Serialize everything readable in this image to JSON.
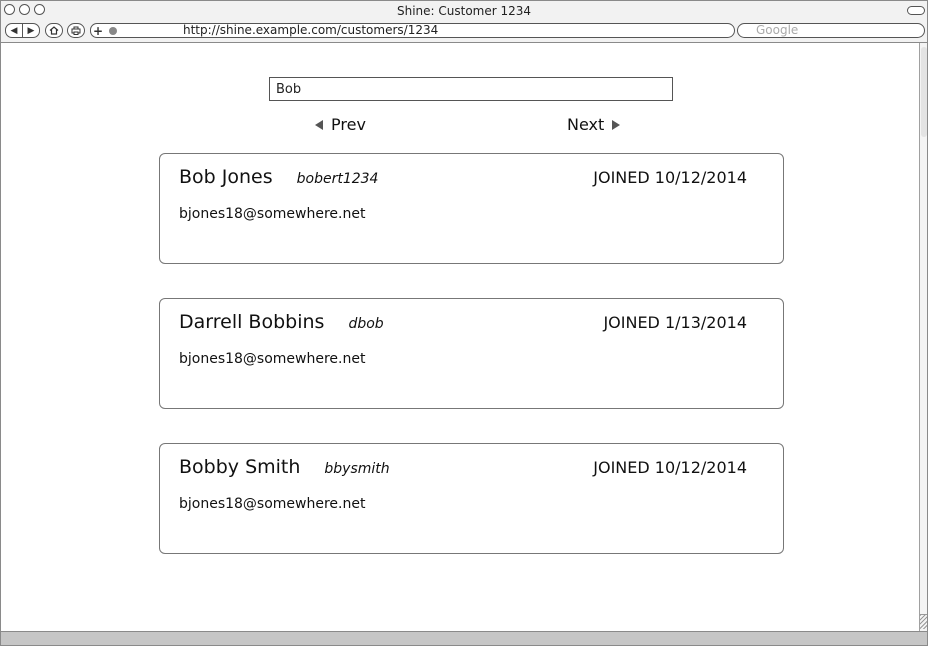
{
  "window": {
    "title": "Shine: Customer 1234",
    "url": "http://shine.example.com/customers/1234",
    "search_placeholder": "Google"
  },
  "toolbar": {
    "back_icon": "back-arrow-icon",
    "forward_icon": "forward-arrow-icon",
    "home_icon": "home-icon",
    "print_icon": "print-icon",
    "add_icon": "plus-icon"
  },
  "search": {
    "value": "Bob"
  },
  "pager": {
    "prev_label": "Prev",
    "next_label": "Next"
  },
  "customers": [
    {
      "name": "Bob Jones",
      "username": "bobert1234",
      "joined": "JOINED 10/12/2014",
      "email": "bjones18@somewhere.net"
    },
    {
      "name": "Darrell Bobbins",
      "username": "dbob",
      "joined": "JOINED 1/13/2014",
      "email": "bjones18@somewhere.net"
    },
    {
      "name": "Bobby Smith",
      "username": "bbysmith",
      "joined": "JOINED 10/12/2014",
      "email": "bjones18@somewhere.net"
    }
  ]
}
